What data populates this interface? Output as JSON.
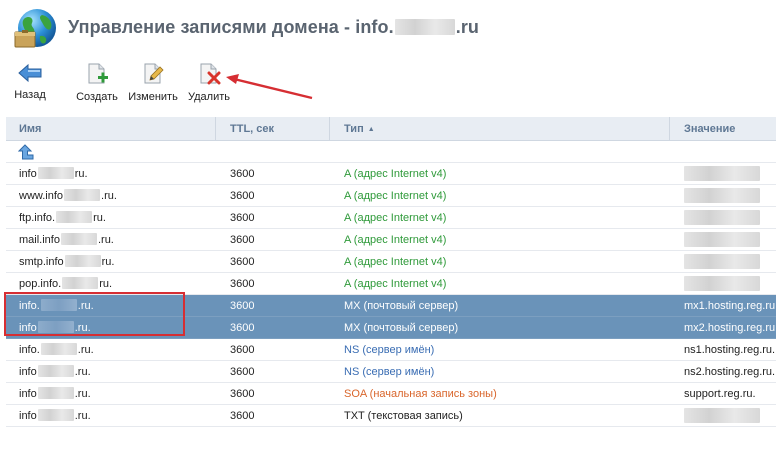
{
  "header": {
    "title_prefix": "Управление записями домена - info.",
    "title_suffix": ".ru"
  },
  "toolbar": {
    "back_label": "Назад",
    "create_label": "Создать",
    "edit_label": "Изменить",
    "delete_label": "Удалить"
  },
  "table": {
    "columns": {
      "name": "Имя",
      "ttl": "TTL, сек",
      "type": "Тип",
      "value": "Значение"
    },
    "sort_column": "Тип",
    "sort_direction": "ascending",
    "rows": [
      {
        "pre": "info",
        "post": "ru.",
        "ttl": "3600",
        "type": "A (адрес Internet v4)",
        "value": "",
        "selected": false
      },
      {
        "pre": "www.info",
        "post": ".ru.",
        "ttl": "3600",
        "type": "A (адрес Internet v4)",
        "value": "",
        "selected": false
      },
      {
        "pre": "ftp.info.",
        "post": "ru.",
        "ttl": "3600",
        "type": "A (адрес Internet v4)",
        "value": "",
        "selected": false
      },
      {
        "pre": "mail.info",
        "post": ".ru.",
        "ttl": "3600",
        "type": "A (адрес Internet v4)",
        "value": "",
        "selected": false
      },
      {
        "pre": "smtp.info",
        "post": "ru.",
        "ttl": "3600",
        "type": "A (адрес Internet v4)",
        "value": "",
        "selected": false
      },
      {
        "pre": "pop.info.",
        "post": "ru.",
        "ttl": "3600",
        "type": "A (адрес Internet v4)",
        "value": "",
        "selected": false
      },
      {
        "pre": "info.",
        "post": ".ru.",
        "ttl": "3600",
        "type": "MX (почтовый сервер)",
        "value": "mx1.hosting.reg.ru.",
        "selected": true
      },
      {
        "pre": "info",
        "post": ".ru.",
        "ttl": "3600",
        "type": "MX (почтовый сервер)",
        "value": "mx2.hosting.reg.ru.",
        "selected": true
      },
      {
        "pre": "info.",
        "post": ".ru.",
        "ttl": "3600",
        "type": "NS (сервер имён)",
        "value": "ns1.hosting.reg.ru.",
        "selected": false
      },
      {
        "pre": "info",
        "post": ".ru.",
        "ttl": "3600",
        "type": "NS (сервер имён)",
        "value": "ns2.hosting.reg.ru.",
        "selected": false
      },
      {
        "pre": "info",
        "post": ".ru.",
        "ttl": "3600",
        "type": "SOA (начальная запись зоны)",
        "value": "support.reg.ru.",
        "selected": false
      },
      {
        "pre": "info",
        "post": ".ru.",
        "ttl": "3600",
        "type": "TXT (текстовая запись)",
        "value": "",
        "selected": false
      }
    ]
  },
  "colors": {
    "a_record": "#2f9a3a",
    "ns_record": "#3a6db3",
    "soa_record": "#d9662c",
    "selection": "#6a93b9",
    "annotation_red": "#d62e33"
  },
  "icons": {
    "app": "globe-icon",
    "back": "back-arrow-icon",
    "create": "add-document-icon",
    "edit": "edit-document-icon",
    "delete": "delete-document-icon",
    "up": "up-level-icon"
  }
}
